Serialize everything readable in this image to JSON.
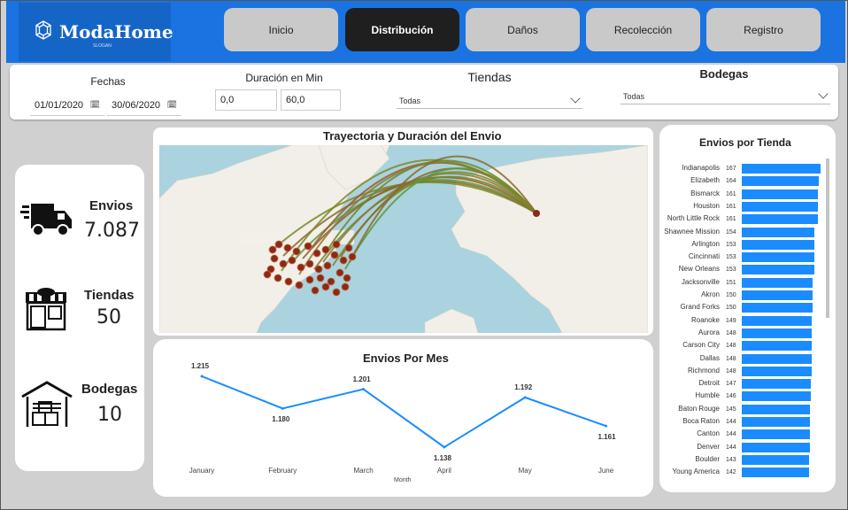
{
  "brand": {
    "name": "ModaHome",
    "slogan": "SLOGAN"
  },
  "nav": [
    {
      "label": "Inicio",
      "active": false
    },
    {
      "label": "Distribución",
      "active": true
    },
    {
      "label": "Daños",
      "active": false
    },
    {
      "label": "Recolección",
      "active": false
    },
    {
      "label": "Registro",
      "active": false
    }
  ],
  "filters": {
    "fechas": {
      "label": "Fechas",
      "start": "01/01/2020",
      "end": "30/06/2020"
    },
    "duracion": {
      "label": "Duración en Min",
      "min": "0,0",
      "max": "60,0"
    },
    "tiendas": {
      "label": "Tiendas",
      "value": "Todas"
    },
    "bodegas": {
      "label": "Bodegas",
      "value": "Todas"
    }
  },
  "kpis": {
    "envios": {
      "label": "Envios",
      "value": "7.087"
    },
    "tiendas": {
      "label": "Tiendas",
      "value": "50"
    },
    "bodegas": {
      "label": "Bodegas",
      "value": "10"
    }
  },
  "map": {
    "title": "Trayectoria y Duración del Envio"
  },
  "line_chart": {
    "title": "Envios Por Mes",
    "xlabel": "Month"
  },
  "bar_chart": {
    "title": "Envios por Tienda"
  },
  "colors": {
    "accent": "#1a73e0",
    "bar": "#1a8cff",
    "line": "#1a8cff",
    "map_dot": "#8b2a1a"
  },
  "chart_data": [
    {
      "type": "line",
      "title": "Envios Por Mes",
      "xlabel": "Month",
      "ylabel": "",
      "categories": [
        "January",
        "February",
        "March",
        "April",
        "May",
        "June"
      ],
      "values": [
        1215,
        1180,
        1201,
        1138,
        1192,
        1161
      ],
      "labels": [
        "1.215",
        "1.180",
        "1.201",
        "1.138",
        "1.192",
        "1.161"
      ],
      "grid": false
    },
    {
      "type": "bar",
      "orientation": "horizontal",
      "title": "Envios por Tienda",
      "categories": [
        "Indianapolis",
        "Elizabeth",
        "Bismarck",
        "Houston",
        "North Little Rock",
        "Shawnee Mission",
        "Arlington",
        "Cincinnati",
        "New Orleans",
        "Jacksonville",
        "Akron",
        "Grand Forks",
        "Roanoke",
        "Aurora",
        "Carson City",
        "Dallas",
        "Richmond",
        "Detroit",
        "Humble",
        "Baton Rouge",
        "Boca Raton",
        "Canton",
        "Denver",
        "Boulder",
        "Young America"
      ],
      "values": [
        167,
        164,
        161,
        161,
        161,
        154,
        153,
        153,
        153,
        151,
        150,
        150,
        149,
        148,
        148,
        148,
        148,
        147,
        146,
        145,
        144,
        144,
        144,
        143,
        142
      ]
    }
  ]
}
